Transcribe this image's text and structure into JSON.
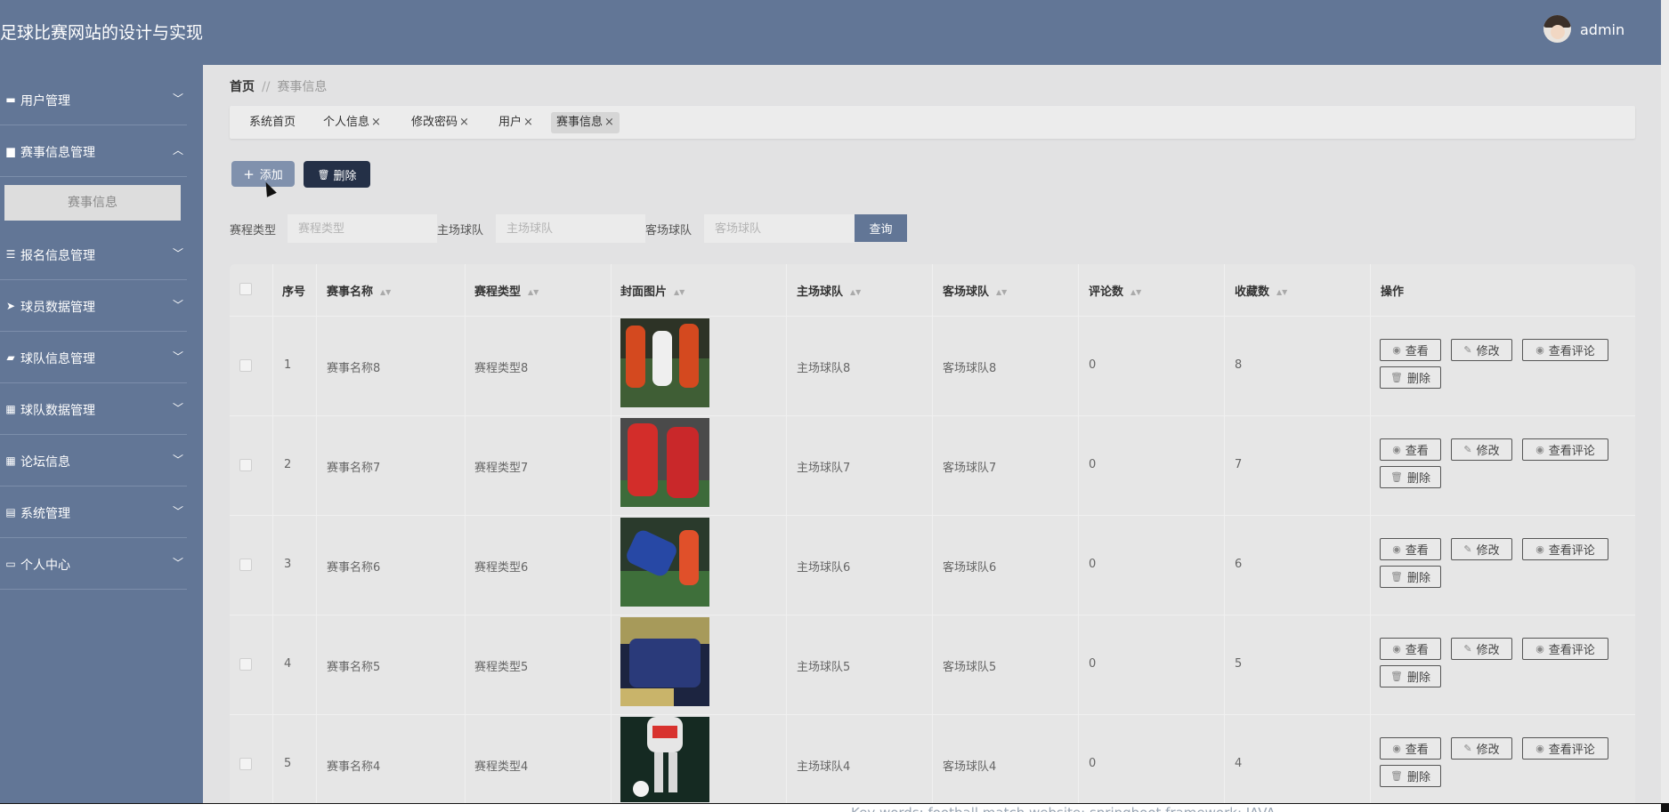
{
  "header": {
    "title": "足球比赛网站的设计与实现",
    "user": "admin"
  },
  "sidebar": {
    "items": [
      {
        "label": "用户管理",
        "icon": "chat-icon",
        "glyph": "▬",
        "chevron": "﹀"
      },
      {
        "label": "赛事信息管理",
        "icon": "briefcase-icon",
        "glyph": "▆",
        "chevron": "︿"
      },
      {
        "label": "报名信息管理",
        "icon": "list-icon",
        "glyph": "☰",
        "chevron": "﹀"
      },
      {
        "label": "球员数据管理",
        "icon": "paper-plane-icon",
        "glyph": "➤",
        "chevron": "﹀"
      },
      {
        "label": "球队信息管理",
        "icon": "ticket-icon",
        "glyph": "▰",
        "chevron": "﹀"
      },
      {
        "label": "球队数据管理",
        "icon": "grid-icon",
        "glyph": "▦",
        "chevron": "﹀"
      },
      {
        "label": "论坛信息",
        "icon": "grid-icon",
        "glyph": "▦",
        "chevron": "﹀"
      },
      {
        "label": "系统管理",
        "icon": "clipboard-icon",
        "glyph": "▤",
        "chevron": "﹀"
      },
      {
        "label": "个人中心",
        "icon": "card-icon",
        "glyph": "▭",
        "chevron": "﹀"
      }
    ],
    "submenu": "赛事信息"
  },
  "breadcrumb": {
    "home": "首页",
    "sep": "//",
    "current": "赛事信息"
  },
  "tabs": [
    {
      "label": "系统首页",
      "closable": false
    },
    {
      "label": "个人信息",
      "closable": true
    },
    {
      "label": "修改密码",
      "closable": true
    },
    {
      "label": "用户",
      "closable": true
    },
    {
      "label": "赛事信息",
      "closable": true,
      "active": true
    }
  ],
  "close_glyph": "×",
  "toolbar": {
    "add": "添加",
    "delete": "删除",
    "add_icon": "+",
    "delete_icon": "🗑"
  },
  "search": {
    "fields": [
      {
        "label": "赛程类型",
        "placeholder": "赛程类型"
      },
      {
        "label": "主场球队",
        "placeholder": "主场球队"
      },
      {
        "label": "客场球队",
        "placeholder": "客场球队"
      }
    ],
    "query": "查询"
  },
  "table": {
    "headers": [
      "序号",
      "赛事名称",
      "赛程类型",
      "封面图片",
      "主场球队",
      "客场球队",
      "评论数",
      "收藏数",
      "操作"
    ],
    "sort_glyph": "▲▼",
    "rows": [
      {
        "no": "1",
        "name": "赛事名称8",
        "type": "赛程类型8",
        "home": "主场球队8",
        "away": "客场球队8",
        "comments": "0",
        "favs": "8"
      },
      {
        "no": "2",
        "name": "赛事名称7",
        "type": "赛程类型7",
        "home": "主场球队7",
        "away": "客场球队7",
        "comments": "0",
        "favs": "7"
      },
      {
        "no": "3",
        "name": "赛事名称6",
        "type": "赛程类型6",
        "home": "主场球队6",
        "away": "客场球队6",
        "comments": "0",
        "favs": "6"
      },
      {
        "no": "4",
        "name": "赛事名称5",
        "type": "赛程类型5",
        "home": "主场球队5",
        "away": "客场球队5",
        "comments": "0",
        "favs": "5"
      },
      {
        "no": "5",
        "name": "赛事名称4",
        "type": "赛程类型4",
        "home": "主场球队4",
        "away": "客场球队4",
        "comments": "0",
        "favs": "4"
      }
    ],
    "actions": {
      "view": "查看",
      "edit": "修改",
      "view_comments": "查看评论",
      "delete": "删除"
    },
    "action_icons": {
      "view": "◉",
      "edit": "✎",
      "delete": "🗑"
    }
  },
  "colors": {
    "header": "#627696",
    "sidebar": "#627696",
    "primary_button": "#8091ad",
    "danger_button": "#243047",
    "query_button": "#627696"
  },
  "caption": "Key words: football match website; springboot framework; JAVA"
}
